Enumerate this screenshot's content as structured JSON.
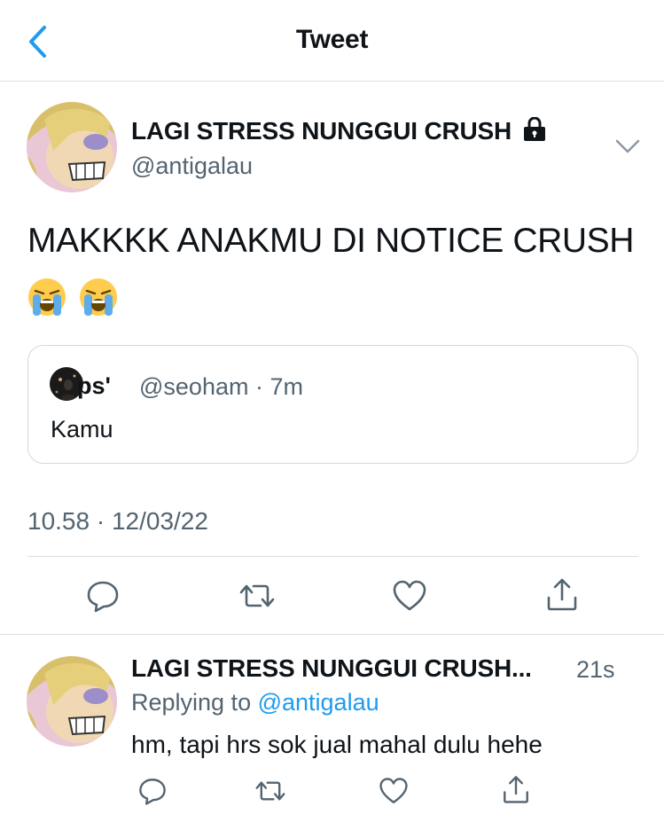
{
  "header": {
    "title": "Tweet",
    "back_icon": "chevron-left-icon"
  },
  "tweet": {
    "author_name": "LAGI STRESS NUNGGUI CRUSH",
    "author_handle": "@antigalau",
    "text": "MAKKKK ANAKMU DI NOTICE CRUSH",
    "emojis": [
      "loudly-crying-face-emoji",
      "loudly-crying-face-emoji"
    ],
    "timestamp": "10.58 · 12/03/22",
    "quoted": {
      "name": "ps'",
      "handle_time": "@seoham · 7m",
      "text": "Kamu"
    }
  },
  "reply": {
    "author_name": "LAGI STRESS NUNGGUI CRUSH...",
    "time": "21s",
    "replying_prefix": "Replying to ",
    "replying_to": "@antigalau",
    "text": "hm, tapi hrs sok jual mahal dulu hehe"
  },
  "colors": {
    "accent": "#1d9bf0",
    "secondary_text": "#536471",
    "border": "#cfd9de"
  }
}
